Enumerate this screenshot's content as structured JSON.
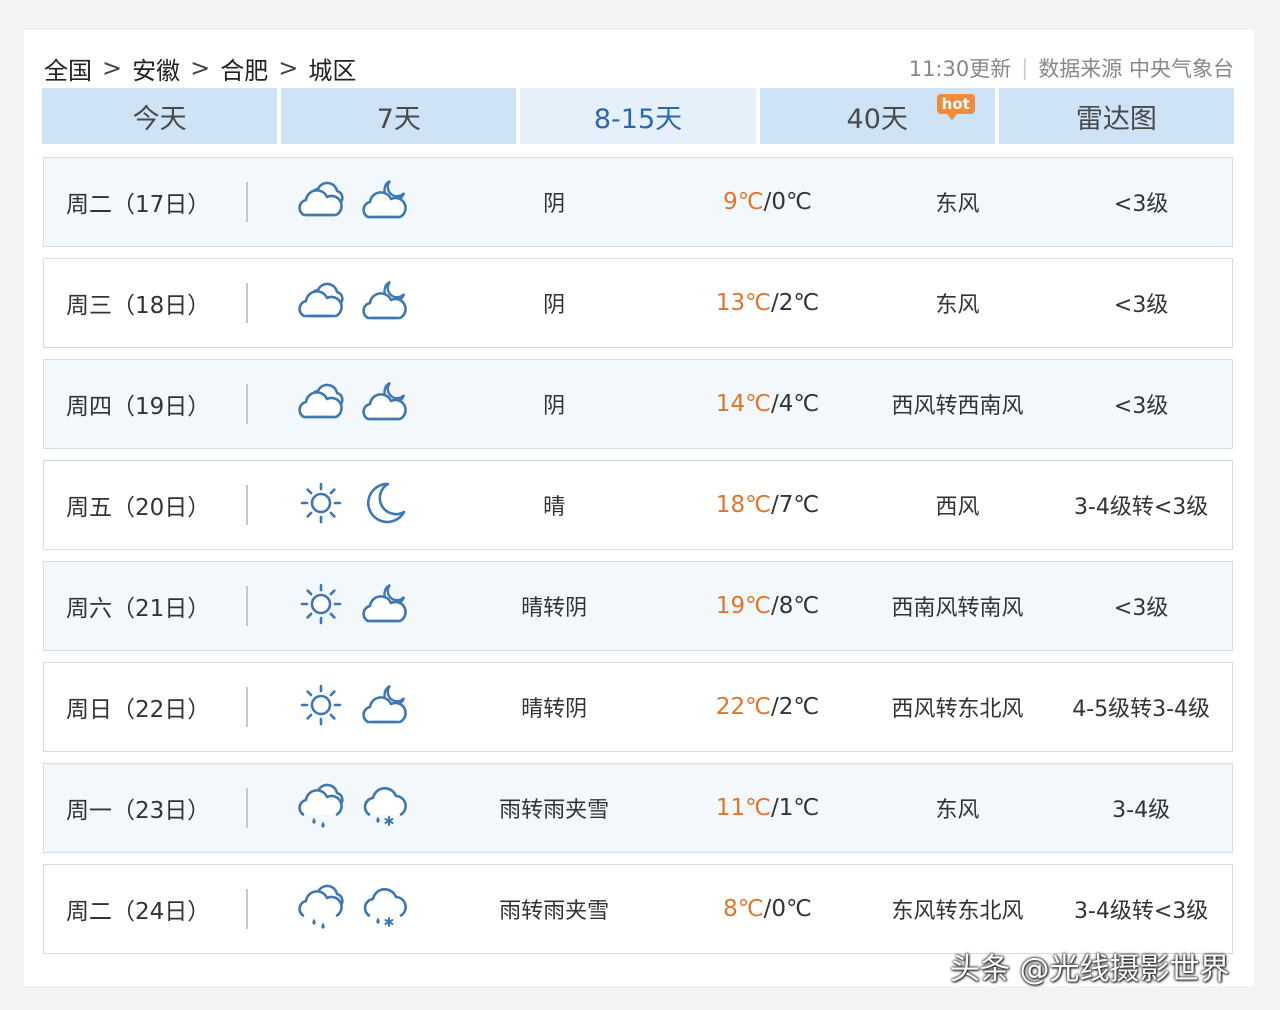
{
  "breadcrumb": [
    "全国",
    "安徽",
    "合肥",
    "城区"
  ],
  "breadcrumb_sep": ">",
  "header": {
    "updated": "11:30更新",
    "source": "数据来源 中央气象台"
  },
  "tabs": [
    {
      "label": "今天"
    },
    {
      "label": "7天"
    },
    {
      "label": "8-15天"
    },
    {
      "label": "40天",
      "badge": "hot"
    },
    {
      "label": "雷达图"
    }
  ],
  "active_tab": "8-15天",
  "colors": {
    "tab_bg": "#cfe3f6",
    "active_tab_text": "#2c67b3",
    "high_temp": "#e2742a",
    "icon": "#3f78b0",
    "row_alt_bg": "#f3f8fd"
  },
  "forecast": [
    {
      "day": "周二（17日）",
      "icon_day": "cloudy-icon",
      "icon_night": "cloud-moon-icon",
      "condition": "阴",
      "high": "9℃",
      "low": "0℃",
      "wind": "东风",
      "level": "<3级"
    },
    {
      "day": "周三（18日）",
      "icon_day": "cloudy-icon",
      "icon_night": "cloud-moon-icon",
      "condition": "阴",
      "high": "13℃",
      "low": "2℃",
      "wind": "东风",
      "level": "<3级"
    },
    {
      "day": "周四（19日）",
      "icon_day": "cloudy-icon",
      "icon_night": "cloud-moon-icon",
      "condition": "阴",
      "high": "14℃",
      "low": "4℃",
      "wind": "西风转西南风",
      "level": "<3级"
    },
    {
      "day": "周五（20日）",
      "icon_day": "sun-icon",
      "icon_night": "moon-icon",
      "condition": "晴",
      "high": "18℃",
      "low": "7℃",
      "wind": "西风",
      "level": "3-4级转<3级"
    },
    {
      "day": "周六（21日）",
      "icon_day": "sun-icon",
      "icon_night": "cloud-moon-icon",
      "condition": "晴转阴",
      "high": "19℃",
      "low": "8℃",
      "wind": "西南风转南风",
      "level": "<3级"
    },
    {
      "day": "周日（22日）",
      "icon_day": "sun-icon",
      "icon_night": "cloud-moon-icon",
      "condition": "晴转阴",
      "high": "22℃",
      "low": "2℃",
      "wind": "西风转东北风",
      "level": "4-5级转3-4级"
    },
    {
      "day": "周一（23日）",
      "icon_day": "rain-icon",
      "icon_night": "sleet-icon",
      "condition": "雨转雨夹雪",
      "high": "11℃",
      "low": "1℃",
      "wind": "东风",
      "level": "3-4级"
    },
    {
      "day": "周二（24日）",
      "icon_day": "rain-icon",
      "icon_night": "sleet-icon",
      "condition": "雨转雨夹雪",
      "high": "8℃",
      "low": "0℃",
      "wind": "东风转东北风",
      "level": "3-4级转<3级"
    }
  ],
  "watermark": "头条 @光线摄影世界"
}
